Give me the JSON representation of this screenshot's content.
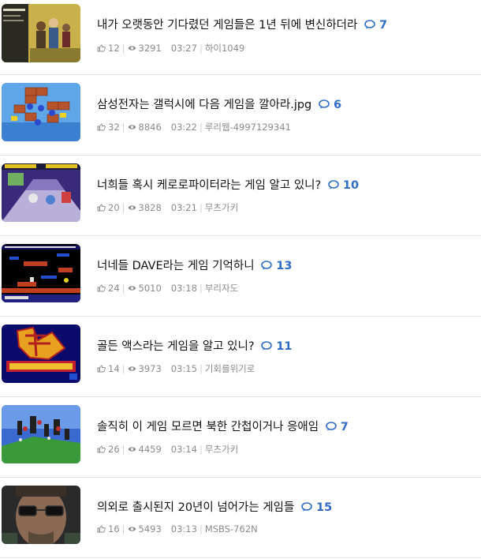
{
  "posts": [
    {
      "title": "내가 오랫동안 기다렸던 게임들은 1년 뒤에 변신하더라",
      "comments": "7",
      "likes": "12",
      "views": "3291",
      "time": "03:27",
      "author": "하이1049"
    },
    {
      "title": "삼성전자는 갤럭시에 다음 게임을 깔아라.jpg",
      "comments": "6",
      "likes": "32",
      "views": "8846",
      "time": "03:22",
      "author": "루리웹-4997129341"
    },
    {
      "title": "너희들 혹시 케로로파이터라는 게임 알고 있니?",
      "comments": "10",
      "likes": "20",
      "views": "3828",
      "time": "03:21",
      "author": "무츠가키"
    },
    {
      "title": "너네들 DAVE라는 게임 기억하니",
      "comments": "13",
      "likes": "24",
      "views": "5010",
      "time": "03:18",
      "author": "부리자도"
    },
    {
      "title": "골든 액스라는 게임을 알고 있니?",
      "comments": "11",
      "likes": "14",
      "views": "3973",
      "time": "03:15",
      "author": "기회를위기로"
    },
    {
      "title": "솔직히 이 게임 모르면 북한 간첩이거나 응애임",
      "comments": "7",
      "likes": "26",
      "views": "4459",
      "time": "03:14",
      "author": "무츠가키"
    },
    {
      "title": "의외로 출시된지 20년이 넘어가는 게임들",
      "comments": "15",
      "likes": "16",
      "views": "5493",
      "time": "03:13",
      "author": "MSBS-762N"
    }
  ],
  "colors": {
    "comment_count": "#2f6cc7",
    "meta_text": "#8a8a8a",
    "divider": "#e4e4e4"
  }
}
